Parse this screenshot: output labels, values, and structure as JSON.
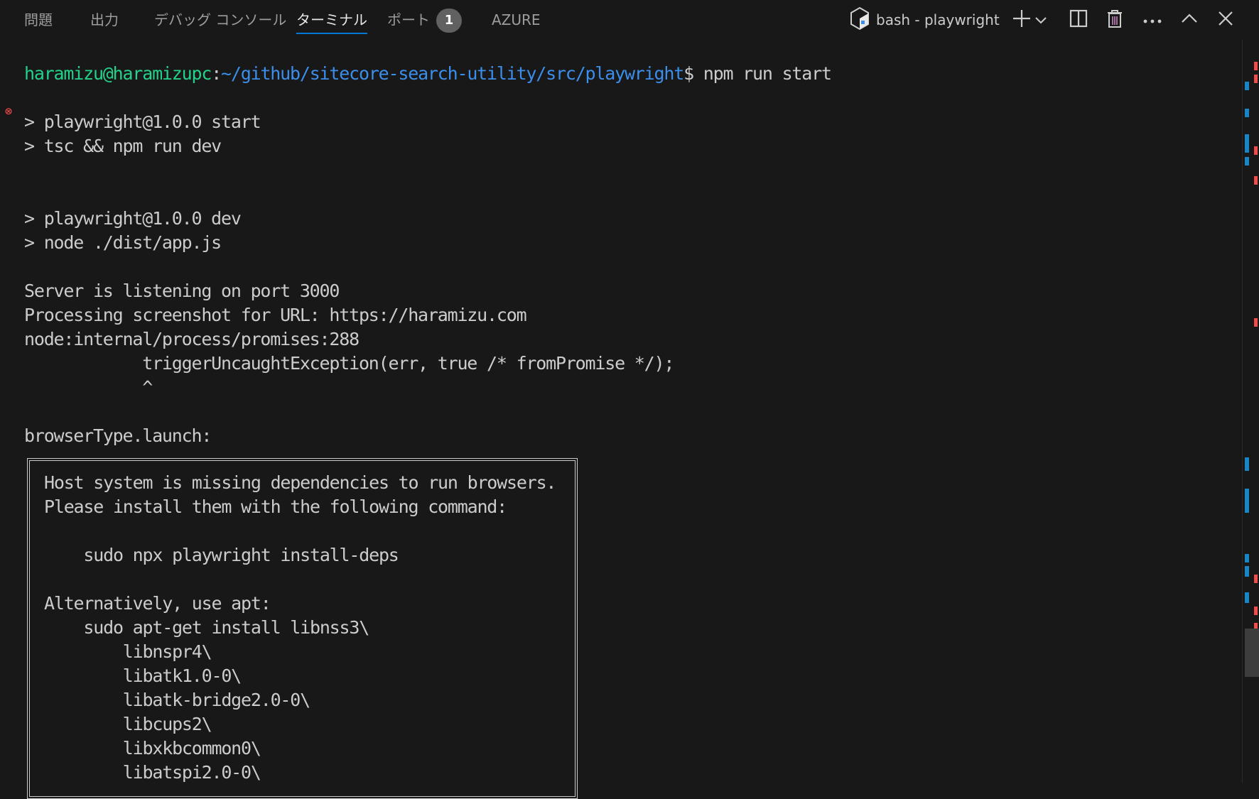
{
  "panel": {
    "tabs": [
      {
        "label": "問題"
      },
      {
        "label": "出力"
      },
      {
        "label": "デバッグ コンソール"
      },
      {
        "label": "ターミナル",
        "active": true
      },
      {
        "label": "ポート",
        "badge": "1"
      },
      {
        "label": "AZURE"
      }
    ],
    "terminal_name": "bash - playwright",
    "actions": {
      "new_terminal": "new-terminal-icon",
      "dropdown": "chevron-down-icon",
      "split": "split-terminal-icon",
      "kill": "trash-icon",
      "more": "ellipsis-icon",
      "maximize": "chevron-up-icon",
      "close": "close-icon"
    }
  },
  "terminal": {
    "prompt": {
      "status_icon": "error-circle-icon",
      "user_host": "haramizu@haramizupc",
      "separator": ":",
      "cwd": "~/github/sitecore-search-utility/src/playwright",
      "symbol": "$",
      "command": " npm run start"
    },
    "lines": [
      "> playwright@1.0.0 start",
      "> tsc && npm run dev",
      "",
      "",
      "> playwright@1.0.0 dev",
      "> node ./dist/app.js",
      "",
      "Server is listening on port 3000",
      "Processing screenshot for URL: https://haramizu.com",
      "node:internal/process/promises:288",
      "            triggerUncaughtException(err, true /* fromPromise */);",
      "            ^",
      "",
      "browserType.launch:"
    ],
    "box_lines": [
      "Host system is missing dependencies to run browsers.",
      "Please install them with the following command:",
      "",
      "    sudo npx playwright install-deps",
      "",
      "Alternatively, use apt:",
      "    sudo apt-get install libnss3\\",
      "        libnspr4\\",
      "        libatk1.0-0\\",
      "        libatk-bridge2.0-0\\",
      "        libcups2\\",
      "        libxkbcommon0\\",
      "        libatspi2.0-0\\"
    ]
  },
  "colors": {
    "background": "#181818",
    "text": "#cccccc",
    "user_host": "#23d18b",
    "cwd": "#3b8eea",
    "error": "#f14c4c",
    "accent": "#0078d4"
  }
}
